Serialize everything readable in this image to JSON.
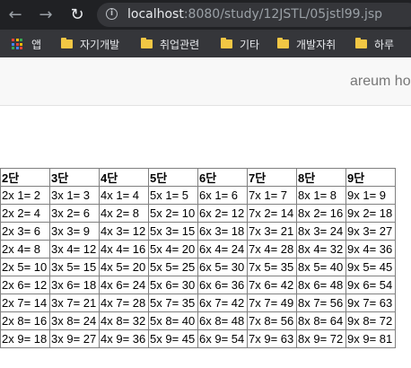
{
  "browser": {
    "url_host": "localhost",
    "url_path": ":8080/study/12JSTL/05jstl99.jsp",
    "bookmarks": [
      {
        "label": "앱",
        "icon": "apps-icon"
      },
      {
        "label": "자기개발",
        "icon": "folder-icon"
      },
      {
        "label": "취업관련",
        "icon": "folder-icon"
      },
      {
        "label": "기타",
        "icon": "folder-icon"
      },
      {
        "label": "개발자취",
        "icon": "folder-icon"
      },
      {
        "label": "하루",
        "icon": "folder-icon"
      }
    ]
  },
  "header": {
    "brand": "areum home"
  },
  "table": {
    "headers": [
      "2단",
      "3단",
      "4단",
      "5단",
      "6단",
      "7단",
      "8단",
      "9단"
    ],
    "rows": [
      [
        "2x 1= 2",
        "3x 1= 3",
        "4x 1= 4",
        "5x 1= 5",
        "6x 1= 6",
        "7x 1= 7",
        "8x 1= 8",
        "9x 1= 9"
      ],
      [
        "2x 2= 4",
        "3x 2= 6",
        "4x 2= 8",
        "5x 2= 10",
        "6x 2= 12",
        "7x 2= 14",
        "8x 2= 16",
        "9x 2= 18"
      ],
      [
        "2x 3= 6",
        "3x 3= 9",
        "4x 3= 12",
        "5x 3= 15",
        "6x 3= 18",
        "7x 3= 21",
        "8x 3= 24",
        "9x 3= 27"
      ],
      [
        "2x 4= 8",
        "3x 4= 12",
        "4x 4= 16",
        "5x 4= 20",
        "6x 4= 24",
        "7x 4= 28",
        "8x 4= 32",
        "9x 4= 36"
      ],
      [
        "2x 5= 10",
        "3x 5= 15",
        "4x 5= 20",
        "5x 5= 25",
        "6x 5= 30",
        "7x 5= 35",
        "8x 5= 40",
        "9x 5= 45"
      ],
      [
        "2x 6= 12",
        "3x 6= 18",
        "4x 6= 24",
        "5x 6= 30",
        "6x 6= 36",
        "7x 6= 42",
        "8x 6= 48",
        "9x 6= 54"
      ],
      [
        "2x 7= 14",
        "3x 7= 21",
        "4x 7= 28",
        "5x 7= 35",
        "6x 7= 42",
        "7x 7= 49",
        "8x 7= 56",
        "9x 7= 63"
      ],
      [
        "2x 8= 16",
        "3x 8= 24",
        "4x 8= 32",
        "5x 8= 40",
        "6x 8= 48",
        "7x 8= 56",
        "8x 8= 64",
        "9x 8= 72"
      ],
      [
        "2x 9= 18",
        "3x 9= 27",
        "4x 9= 36",
        "5x 9= 45",
        "6x 9= 54",
        "7x 9= 63",
        "8x 9= 72",
        "9x 9= 81"
      ]
    ]
  },
  "colors": {
    "topbar": "#202124",
    "bookmarks_bar": "#35363a",
    "folder": "#f2c744",
    "header_bg": "#f8f8f8",
    "brand_text": "#777777"
  }
}
